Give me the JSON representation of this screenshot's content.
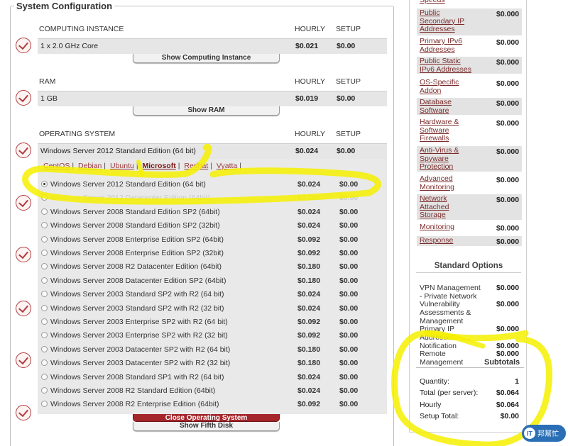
{
  "legend": "System Configuration",
  "sections": {
    "computing": {
      "title": "COMPUTING INSTANCE",
      "hourly_label": "HOURLY",
      "setup_label": "SETUP",
      "selected": "1 x 2.0 GHz Core",
      "price": "$0.021",
      "setup": "$0.00",
      "button": "Show Computing Instance"
    },
    "ram": {
      "title": "RAM",
      "hourly_label": "HOURLY",
      "setup_label": "SETUP",
      "selected": "1 GB",
      "price": "$0.019",
      "setup": "$0.00",
      "button": "Show RAM"
    },
    "os": {
      "title": "OPERATING SYSTEM",
      "hourly_label": "HOURLY",
      "setup_label": "SETUP",
      "selected": "Windows Server 2012 Standard Edition (64 bit)",
      "price": "$0.024",
      "setup": "$0.00",
      "links": [
        "CentOS",
        "Debian",
        "Ubuntu",
        "Microsoft",
        "Redhat",
        "Vyatta"
      ],
      "active_link": "Microsoft",
      "options": [
        {
          "name": "Windows Server 2012 Standard Edition (64 bit)",
          "price": "$0.024",
          "setup": "$0.00",
          "selected": true
        },
        {
          "name": "Windows Server 2012 Datacenter Edition (64bit)",
          "price": "$0.180",
          "setup": "$0.00",
          "faded": true
        },
        {
          "name": "Windows Server 2008 Standard Edition SP2 (64bit)",
          "price": "$0.024",
          "setup": "$0.00"
        },
        {
          "name": "Windows Server 2008 Standard Edition SP2 (32bit)",
          "price": "$0.024",
          "setup": "$0.00"
        },
        {
          "name": "Windows Server 2008 Enterprise Edition SP2 (64bit)",
          "price": "$0.092",
          "setup": "$0.00"
        },
        {
          "name": "Windows Server 2008 Enterprise Edition SP2 (32bit)",
          "price": "$0.092",
          "setup": "$0.00"
        },
        {
          "name": "Windows Server 2008 R2 Datacenter Edition (64bit)",
          "price": "$0.180",
          "setup": "$0.00"
        },
        {
          "name": "Windows Server 2008 Datacenter Edition SP2 (64bit)",
          "price": "$0.180",
          "setup": "$0.00"
        },
        {
          "name": "Windows Server 2003 Standard SP2 with R2 (64 bit)",
          "price": "$0.024",
          "setup": "$0.00"
        },
        {
          "name": "Windows Server 2003 Standard SP2 with R2 (32 bit)",
          "price": "$0.024",
          "setup": "$0.00"
        },
        {
          "name": "Windows Server 2003 Enterprise SP2 with R2 (64 bit)",
          "price": "$0.092",
          "setup": "$0.00"
        },
        {
          "name": "Windows Server 2003 Enterprise SP2 with R2 (32 bit)",
          "price": "$0.092",
          "setup": "$0.00"
        },
        {
          "name": "Windows Server 2003 Datacenter SP2 with R2 (64 bit)",
          "price": "$0.180",
          "setup": "$0.00"
        },
        {
          "name": "Windows Server 2003 Datacenter SP2 with R2 (32 bit)",
          "price": "$0.180",
          "setup": "$0.00"
        },
        {
          "name": "Windows Server 2008 Standard SP1 with R2 (64 bit)",
          "price": "$0.024",
          "setup": "$0.00"
        },
        {
          "name": "Windows Server 2008 R2 Standard Edition (64bit)",
          "price": "$0.024",
          "setup": "$0.00"
        },
        {
          "name": "Windows Server 2008 R2 Enterprise Edition (64bit)",
          "price": "$0.092",
          "setup": "$0.00"
        }
      ],
      "close_button": "Close Operating System",
      "next_button": "Show Fifth Disk"
    }
  },
  "sidebar": {
    "addons": [
      {
        "label": "Speeds",
        "value": "",
        "shade": false
      },
      {
        "label": "Public Secondary IP Addresses",
        "value": "$0.000",
        "shade": true
      },
      {
        "label": "Primary IPv6 Addresses",
        "value": "$0.000",
        "shade": false
      },
      {
        "label": "Public Static IPv6 Addresses",
        "value": "$0.000",
        "shade": true
      },
      {
        "label": "OS-Specific Addon",
        "value": "$0.000",
        "shade": false
      },
      {
        "label": "Database Software",
        "value": "$0.000",
        "shade": true
      },
      {
        "label": "Hardware & Software Firewalls",
        "value": "$0.000",
        "shade": false
      },
      {
        "label": "Anti-Virus & Spyware Protection",
        "value": "$0.000",
        "shade": true
      },
      {
        "label": "Advanced Monitoring",
        "value": "$0.000",
        "shade": false
      },
      {
        "label": "Network Attached Storage",
        "value": "$0.000",
        "shade": true
      },
      {
        "label": "Monitoring",
        "value": "$0.000",
        "shade": false
      },
      {
        "label": "Response",
        "value": "$0.000",
        "shade": true
      }
    ],
    "standard_title": "Standard Options",
    "standard": [
      {
        "label": "VPN Management - Private Network",
        "value": "$0.000"
      },
      {
        "label": "Vulnerability Assessments & Management",
        "value": "$0.000"
      },
      {
        "label": "Primary IP Addresses",
        "value": "$0.000"
      },
      {
        "label": "Notification",
        "value": "$0.000"
      },
      {
        "label": "Remote Management",
        "value": "$0.000"
      }
    ],
    "subtotals_title": "Subtotals",
    "subtotals": [
      {
        "label": "Quantity:",
        "value": "1"
      },
      {
        "label": "Total (per server):",
        "value": "$0.064"
      },
      {
        "label": "Hourly",
        "value": "$0.064"
      },
      {
        "label": "Setup Total:",
        "value": "$0.00"
      }
    ]
  },
  "watermark": "IT邦幫忙",
  "colors": {
    "highlight": "#f5f000",
    "accent_red": "#a4252a",
    "link": "#7c2b2b"
  }
}
